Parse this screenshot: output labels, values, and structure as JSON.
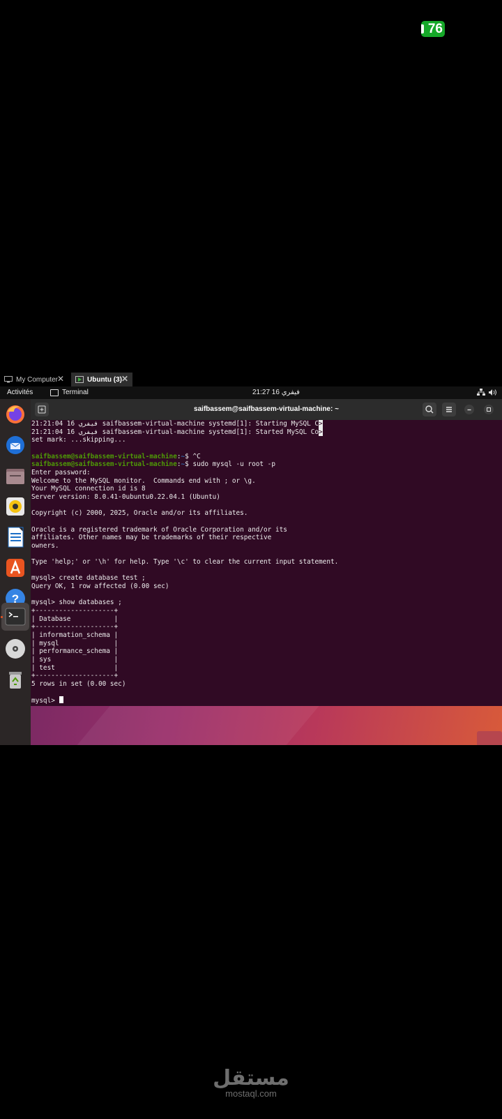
{
  "status": {
    "battery_level": "76"
  },
  "vm_tabs": [
    {
      "label": "My Computer",
      "active": false
    },
    {
      "label": "Ubuntu (3)",
      "active": true
    }
  ],
  "topbar": {
    "activities": "Activités",
    "app_label": "Terminal",
    "clock": "21:27 16 فيفري"
  },
  "dock": {
    "apps": [
      "firefox-icon",
      "thunderbird-icon",
      "files-icon",
      "rhythmbox-icon",
      "libreoffice-writer-icon",
      "app-center-icon",
      "help-icon",
      "terminal-icon",
      "dvd-icon",
      "trash-icon"
    ]
  },
  "terminal": {
    "title": "saifbassem@saifbassem-virtual-machine: ~",
    "lines": [
      {
        "text": "21:21:04 16 فيفري saifbassem-virtual-machine systemd[1]: Starting MySQL C",
        "trunc": ">"
      },
      {
        "text": "21:21:04 16 فيفري saifbassem-virtual-machine systemd[1]: Started MySQL Co",
        "trunc": ">"
      },
      {
        "text": "set mark: ...skipping..."
      },
      {
        "text": ""
      },
      {
        "user": "saifbassem@saifbassem-virtual-machine",
        "path": "~",
        "cmd": "$ ^C"
      },
      {
        "user": "saifbassem@saifbassem-virtual-machine",
        "path": "~",
        "cmd": "$ sudo mysql -u root -p"
      },
      {
        "text": "Enter password:"
      },
      {
        "text": "Welcome to the MySQL monitor.  Commands end with ; or \\g."
      },
      {
        "text": "Your MySQL connection id is 8"
      },
      {
        "text": "Server version: 8.0.41-0ubuntu0.22.04.1 (Ubuntu)"
      },
      {
        "text": ""
      },
      {
        "text": "Copyright (c) 2000, 2025, Oracle and/or its affiliates."
      },
      {
        "text": ""
      },
      {
        "text": "Oracle is a registered trademark of Oracle Corporation and/or its"
      },
      {
        "text": "affiliates. Other names may be trademarks of their respective"
      },
      {
        "text": "owners."
      },
      {
        "text": ""
      },
      {
        "text": "Type 'help;' or '\\h' for help. Type '\\c' to clear the current input statement."
      },
      {
        "text": ""
      },
      {
        "text": "mysql> create database test ;"
      },
      {
        "text": "Query OK, 1 row affected (0.00 sec)"
      },
      {
        "text": ""
      },
      {
        "text": "mysql> show databases ;"
      },
      {
        "text": "+--------------------+"
      },
      {
        "text": "| Database           |"
      },
      {
        "text": "+--------------------+"
      },
      {
        "text": "| information_schema |"
      },
      {
        "text": "| mysql              |"
      },
      {
        "text": "| performance_schema |"
      },
      {
        "text": "| sys                |"
      },
      {
        "text": "| test               |"
      },
      {
        "text": "+--------------------+"
      },
      {
        "text": "5 rows in set (0.00 sec)"
      },
      {
        "text": ""
      },
      {
        "text": "mysql> ",
        "cursor": true
      }
    ]
  },
  "watermark": {
    "arabic": "مستقل",
    "latin": "mostaql.com"
  }
}
